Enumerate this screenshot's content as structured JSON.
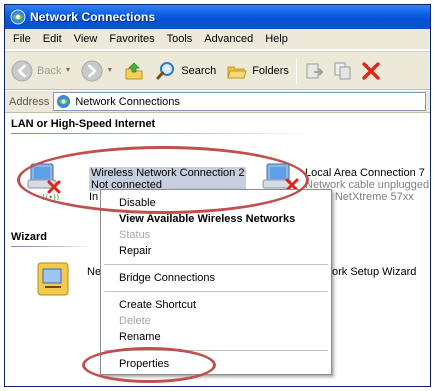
{
  "window": {
    "title": "Network Connections"
  },
  "menubar": [
    "File",
    "Edit",
    "View",
    "Favorites",
    "Tools",
    "Advanced",
    "Help"
  ],
  "toolbar": {
    "back_label": "Back",
    "search_label": "Search",
    "folders_label": "Folders"
  },
  "address": {
    "label": "Address",
    "value": "Network Connections"
  },
  "groups": {
    "lan_title": "LAN or High-Speed Internet",
    "wizard_title": "Wizard"
  },
  "connections": {
    "wireless": {
      "name": "Wireless Network Connection 2",
      "status": "Not connected",
      "device_partial": "In"
    },
    "lan": {
      "name": "Local Area Connection 7",
      "status": "Network cable unplugged",
      "device_partial": "com NetXtreme 57xx"
    }
  },
  "wizard": {
    "left_partial": "Ne",
    "right_partial": "ork Setup Wizard"
  },
  "context_menu": {
    "disable": "Disable",
    "view_wireless": "View Available Wireless Networks",
    "status": "Status",
    "repair": "Repair",
    "bridge": "Bridge Connections",
    "shortcut": "Create Shortcut",
    "delete": "Delete",
    "rename": "Rename",
    "properties": "Properties"
  },
  "colors": {
    "titlebar": "#0a5fe2",
    "annotation": "#c0504d",
    "selection": "#c7cfde"
  },
  "icons": [
    "network-connections-icon",
    "back-arrow-icon",
    "forward-arrow-icon",
    "up-folder-icon",
    "search-icon",
    "folders-icon",
    "move-to-icon",
    "copy-to-icon",
    "delete-x-icon",
    "wireless-adapter-icon",
    "lan-adapter-icon",
    "wizard-icon"
  ]
}
